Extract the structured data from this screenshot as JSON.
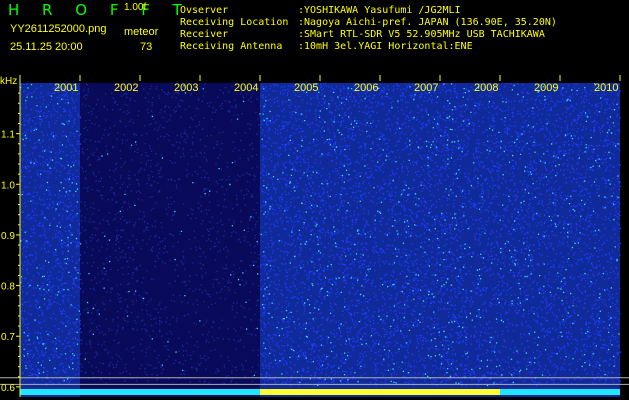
{
  "header": {
    "brand": "H R O F F T",
    "version": "1.00f",
    "filename": "YY2611252000.png",
    "datetime": "25.11.25 20:00",
    "meteor_label": "meteor",
    "meteor_count": "73",
    "info": [
      {
        "label": "Ovserver",
        "value": ":YOSHIKAWA Yasufumi /JG2MLI"
      },
      {
        "label": "Receiving Location",
        "value": ":Nagoya Aichi-pref. JAPAN (136.90E, 35.20N)"
      },
      {
        "label": "Receiver",
        "value": ":SMart RTL-SDR V5 52.905MHz USB TACHIKAWA"
      },
      {
        "label": "Receiving Antenna",
        "value": ":10mH 3el.YAGI Horizontal:ENE"
      }
    ]
  },
  "colors": {
    "text_green": "#00ff00",
    "text_yellow": "#ffff00",
    "background": "#000000",
    "noise_dark": "#0a0a6e",
    "noise_bright": "#1e3cff",
    "speck": "#39d8ff"
  },
  "chart_data": {
    "type": "heatmap",
    "ylabel": "kHz",
    "y_ticks": [
      "1.1",
      "1.0",
      "0.9",
      "0.8",
      "0.7",
      "0.6"
    ],
    "ylim": [
      0.58,
      1.2
    ],
    "x_ticks": [
      "2001",
      "2002",
      "2003",
      "2004",
      "2005",
      "2006",
      "2007",
      "2008",
      "2009",
      "2010"
    ],
    "xlim": [
      0,
      10
    ],
    "segments": [
      {
        "from": 0,
        "to": 1,
        "intensity": 0.9
      },
      {
        "from": 1,
        "to": 4,
        "intensity": 0.35
      },
      {
        "from": 4,
        "to": 7,
        "intensity": 0.9
      },
      {
        "from": 7,
        "to": 7.3,
        "intensity": 1.0
      },
      {
        "from": 7.3,
        "to": 10,
        "intensity": 0.85
      }
    ],
    "reference_lines_khz": [
      0.618,
      0.605
    ],
    "bottom_strip": [
      {
        "from": 0,
        "to": 1,
        "color": "cyan"
      },
      {
        "from": 1,
        "to": 4,
        "color": "cyan"
      },
      {
        "from": 4,
        "to": 7,
        "color": "yellow"
      },
      {
        "from": 7,
        "to": 8,
        "color": "yellow"
      },
      {
        "from": 8,
        "to": 10,
        "color": "cyan"
      }
    ]
  }
}
